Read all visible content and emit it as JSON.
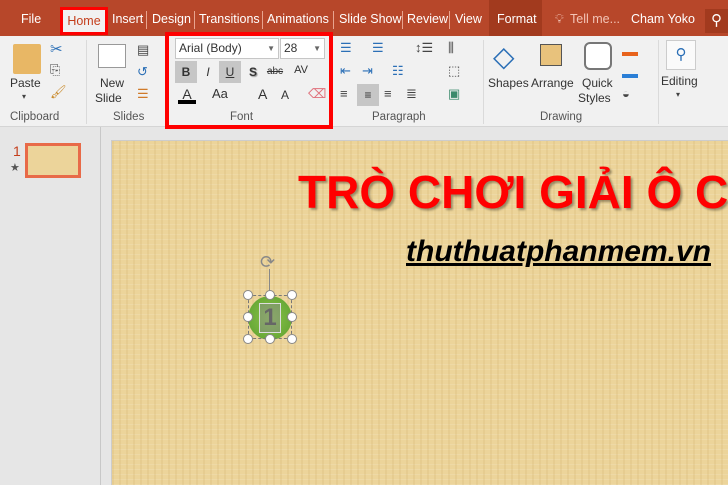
{
  "tabs": {
    "file": "File",
    "home": "Home",
    "insert": "Insert",
    "design": "Design",
    "transitions": "Transitions",
    "animations": "Animations",
    "slideshow": "Slide Show",
    "review": "Review",
    "view": "View",
    "format": "Format",
    "tellme": "Tell me...",
    "user": "Cham Yoko"
  },
  "ribbon": {
    "clipboard": {
      "paste": "Paste",
      "label": "Clipboard"
    },
    "slides": {
      "new_slide_1": "New",
      "new_slide_2": "Slide",
      "label": "Slides"
    },
    "font": {
      "font_name": "Arial (Body)",
      "font_size": "28",
      "bold": "B",
      "italic": "I",
      "underline": "U",
      "shadow": "S",
      "strike": "abc",
      "spacing": "AV",
      "color": "A",
      "case": "Aa",
      "grow": "A",
      "shrink": "A",
      "label": "Font"
    },
    "paragraph": {
      "label": "Paragraph"
    },
    "drawing": {
      "shapes": "Shapes",
      "arrange": "Arrange",
      "quick_1": "Quick",
      "quick_2": "Styles",
      "label": "Drawing"
    },
    "editing": {
      "label": "Editing"
    }
  },
  "thumbs": [
    {
      "number": "1"
    }
  ],
  "slide": {
    "title": "TRÒ CHƠI GIẢI Ô C",
    "subtitle": "thuthuatphanmem.vn",
    "shape_text": "1"
  },
  "colors": {
    "accent": "#b7472a",
    "highlight": "#ff0000"
  }
}
